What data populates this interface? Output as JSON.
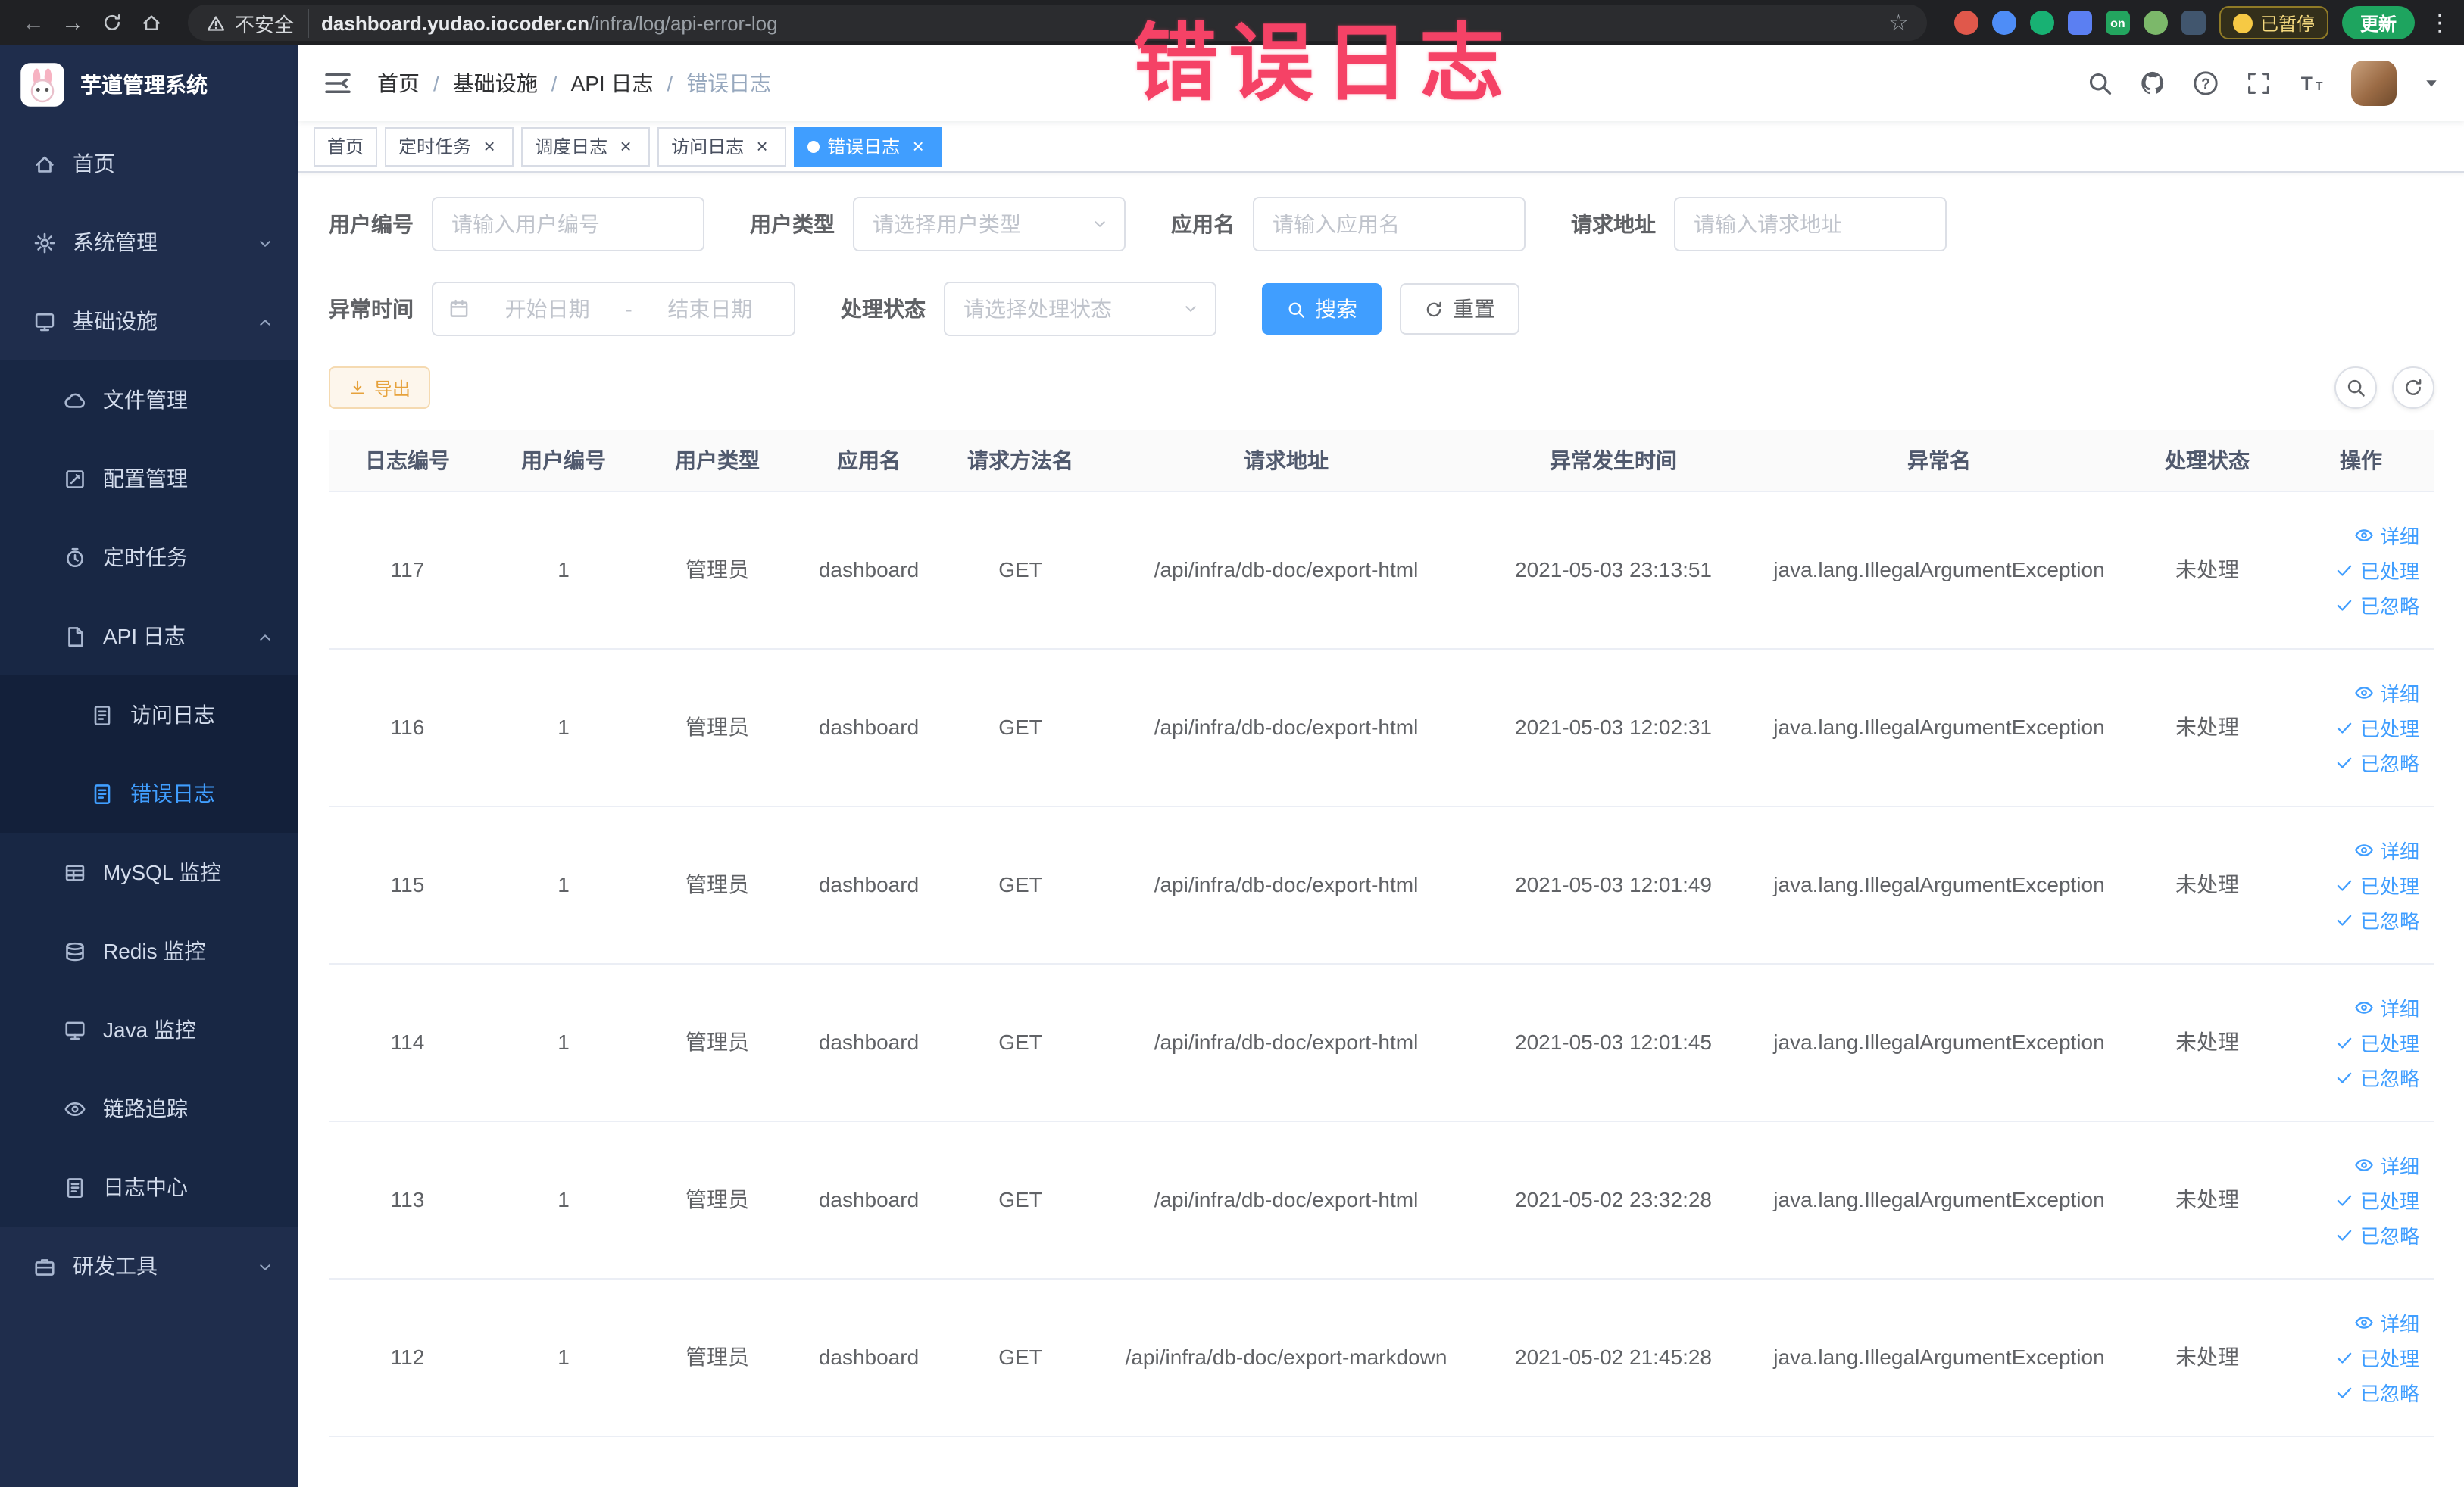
{
  "browser": {
    "security_label": "不安全",
    "url_host": "dashboard.yudao.iocoder.cn",
    "url_path": "/infra/log/api-error-log",
    "paused_badge_label": "已暂停",
    "update_button_label": "更新",
    "extensions": [
      {
        "name": "extension-icon-red",
        "color": "#e0584b",
        "shape": "circle",
        "text": ""
      },
      {
        "name": "extension-icon-blue",
        "color": "#4e8df7",
        "shape": "circle",
        "text": ""
      },
      {
        "name": "extension-icon-green",
        "color": "#18b173",
        "shape": "circle",
        "text": ""
      },
      {
        "name": "extension-icon-grid",
        "color": "#5b7ff2",
        "shape": "square",
        "text": ""
      },
      {
        "name": "extension-icon-on-badge",
        "color": "#23a55f",
        "shape": "square",
        "text": "on"
      },
      {
        "name": "extension-icon-leaf",
        "color": "#7cb86a",
        "shape": "circle",
        "text": ""
      },
      {
        "name": "extension-icon-tree",
        "color": "#41566e",
        "shape": "square",
        "text": ""
      }
    ]
  },
  "overlay_annotation": {
    "text": "错误日志",
    "color": "#f54266"
  },
  "sidebar": {
    "app_title": "芋道管理系统",
    "menu": [
      {
        "key": "home",
        "label": "首页",
        "icon": "home-icon",
        "level": 1
      },
      {
        "key": "system",
        "label": "系统管理",
        "icon": "gear-icon",
        "level": 1,
        "arrow": "down"
      },
      {
        "key": "infra",
        "label": "基础设施",
        "icon": "infra-icon",
        "level": 1,
        "arrow": "up"
      },
      {
        "key": "file",
        "label": "文件管理",
        "icon": "file-icon",
        "level": 2
      },
      {
        "key": "config",
        "label": "配置管理",
        "icon": "config-icon",
        "level": 2
      },
      {
        "key": "job",
        "label": "定时任务",
        "icon": "timer-icon",
        "level": 2
      },
      {
        "key": "api-log",
        "label": "API 日志",
        "icon": "log-icon",
        "level": 2,
        "arrow": "up"
      },
      {
        "key": "access-log",
        "label": "访问日志",
        "icon": "doc-icon",
        "level": 3
      },
      {
        "key": "error-log",
        "label": "错误日志",
        "icon": "doc-icon",
        "level": 3,
        "active": true
      },
      {
        "key": "mysql",
        "label": "MySQL 监控",
        "icon": "database-icon",
        "level": 2
      },
      {
        "key": "redis",
        "label": "Redis 监控",
        "icon": "layers-icon",
        "level": 2
      },
      {
        "key": "java",
        "label": "Java 监控",
        "icon": "monitor-icon",
        "level": 2
      },
      {
        "key": "trace",
        "label": "链路追踪",
        "icon": "eye-icon",
        "level": 2
      },
      {
        "key": "log-center",
        "label": "日志中心",
        "icon": "doc-icon",
        "level": 2
      },
      {
        "key": "dev-tools",
        "label": "研发工具",
        "icon": "tools-icon",
        "level": 1,
        "arrow": "down"
      }
    ]
  },
  "navbar": {
    "breadcrumbs": [
      "首页",
      "基础设施",
      "API 日志",
      "错误日志"
    ]
  },
  "tags": [
    {
      "label": "首页",
      "closable": false,
      "active": false
    },
    {
      "label": "定时任务",
      "closable": true,
      "active": false
    },
    {
      "label": "调度日志",
      "closable": true,
      "active": false
    },
    {
      "label": "访问日志",
      "closable": true,
      "active": false
    },
    {
      "label": "错误日志",
      "closable": true,
      "active": true
    }
  ],
  "filters": {
    "user_id": {
      "label": "用户编号",
      "placeholder": "请输入用户编号"
    },
    "user_type": {
      "label": "用户类型",
      "placeholder": "请选择用户类型"
    },
    "app_name": {
      "label": "应用名",
      "placeholder": "请输入应用名"
    },
    "request_url": {
      "label": "请求地址",
      "placeholder": "请输入请求地址"
    },
    "exception_time": {
      "label": "异常时间",
      "start_placeholder": "开始日期",
      "separator": "-",
      "end_placeholder": "结束日期"
    },
    "process_status": {
      "label": "处理状态",
      "placeholder": "请选择处理状态"
    },
    "search_button_label": "搜索",
    "reset_button_label": "重置"
  },
  "toolbar": {
    "export_label": "导出"
  },
  "table": {
    "columns": [
      {
        "key": "id",
        "label": "日志编号"
      },
      {
        "key": "user_id",
        "label": "用户编号"
      },
      {
        "key": "user_type",
        "label": "用户类型"
      },
      {
        "key": "app",
        "label": "应用名"
      },
      {
        "key": "method",
        "label": "请求方法名"
      },
      {
        "key": "url",
        "label": "请求地址"
      },
      {
        "key": "time",
        "label": "异常发生时间"
      },
      {
        "key": "exception",
        "label": "异常名"
      },
      {
        "key": "status",
        "label": "处理状态"
      },
      {
        "key": "actions",
        "label": "操作"
      }
    ],
    "row_actions": [
      {
        "name": "detail-link",
        "label": "详细",
        "icon": "eye-icon"
      },
      {
        "name": "processed-link",
        "label": "已处理",
        "icon": "check-icon"
      },
      {
        "name": "ignored-link",
        "label": "已忽略",
        "icon": "check-icon"
      }
    ],
    "rows": [
      {
        "id": "117",
        "user_id": "1",
        "user_type": "管理员",
        "app": "dashboard",
        "method": "GET",
        "url": "/api/infra/db-doc/export-html",
        "time": "2021-05-03 23:13:51",
        "exception": "java.lang.IllegalArgumentException",
        "status": "未处理"
      },
      {
        "id": "116",
        "user_id": "1",
        "user_type": "管理员",
        "app": "dashboard",
        "method": "GET",
        "url": "/api/infra/db-doc/export-html",
        "time": "2021-05-03 12:02:31",
        "exception": "java.lang.IllegalArgumentException",
        "status": "未处理"
      },
      {
        "id": "115",
        "user_id": "1",
        "user_type": "管理员",
        "app": "dashboard",
        "method": "GET",
        "url": "/api/infra/db-doc/export-html",
        "time": "2021-05-03 12:01:49",
        "exception": "java.lang.IllegalArgumentException",
        "status": "未处理"
      },
      {
        "id": "114",
        "user_id": "1",
        "user_type": "管理员",
        "app": "dashboard",
        "method": "GET",
        "url": "/api/infra/db-doc/export-html",
        "time": "2021-05-03 12:01:45",
        "exception": "java.lang.IllegalArgumentException",
        "status": "未处理"
      },
      {
        "id": "113",
        "user_id": "1",
        "user_type": "管理员",
        "app": "dashboard",
        "method": "GET",
        "url": "/api/infra/db-doc/export-html",
        "time": "2021-05-02 23:32:28",
        "exception": "java.lang.IllegalArgumentException",
        "status": "未处理"
      },
      {
        "id": "112",
        "user_id": "1",
        "user_type": "管理员",
        "app": "dashboard",
        "method": "GET",
        "url": "/api/infra/db-doc/export-markdown",
        "time": "2021-05-02 21:45:28",
        "exception": "java.lang.IllegalArgumentException",
        "status": "未处理"
      }
    ]
  }
}
